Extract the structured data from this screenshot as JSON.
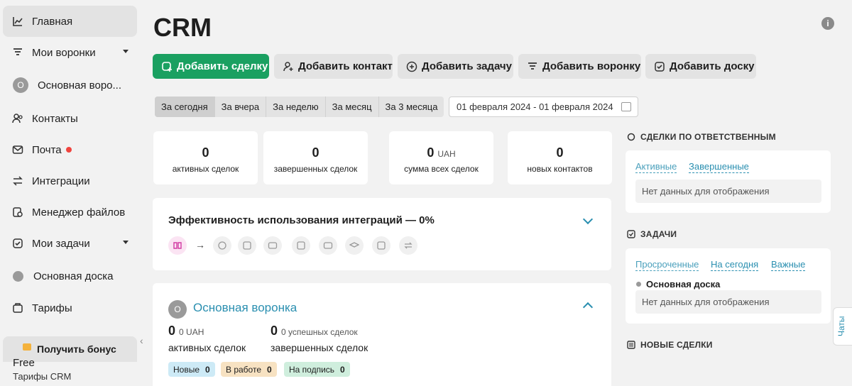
{
  "sidebar": {
    "items": [
      {
        "label": "Главная",
        "icon": "chart-line-icon"
      },
      {
        "label": "Мои воронки",
        "icon": "funnel-icon"
      },
      {
        "label": "Основная воро...",
        "icon": "funnel-avatar-icon",
        "avatar": "О"
      },
      {
        "label": "Контакты",
        "icon": "contacts-icon"
      },
      {
        "label": "Почта",
        "icon": "mail-icon"
      },
      {
        "label": "Интеграции",
        "icon": "integrations-icon"
      },
      {
        "label": "Менеджер файлов",
        "icon": "files-icon"
      },
      {
        "label": "Мои задачи",
        "icon": "tasks-icon"
      },
      {
        "label": "Основная доска",
        "icon": "board-dot-icon"
      },
      {
        "label": "Тарифы",
        "icon": "tariffs-icon"
      }
    ],
    "bonus_label": "Получить бонус",
    "plan_name": "Free",
    "plan_sub": "Тарифы CRM"
  },
  "header": {
    "title": "CRM"
  },
  "actions": {
    "add_deal": "Добавить сделку",
    "add_contact": "Добавить контакт",
    "add_task": "Добавить задачу",
    "add_funnel": "Добавить воронку",
    "add_board": "Добавить доску"
  },
  "periods": [
    "За сегодня",
    "За вчера",
    "За неделю",
    "За месяц",
    "За 3 месяца"
  ],
  "date_range": "01 февраля 2024 - 01 февраля 2024",
  "stats": [
    {
      "value": "0",
      "unit": "",
      "label": "активных сделок"
    },
    {
      "value": "0",
      "unit": "",
      "label": "завершенных сделок"
    },
    {
      "value": "0",
      "unit": "UAH",
      "label": "сумма всех сделок"
    },
    {
      "value": "0",
      "unit": "",
      "label": "новых контактов"
    }
  ],
  "efficiency": {
    "title": "Эффективность использования интеграций — 0%"
  },
  "funnel": {
    "avatar": "О",
    "name": "Основная воронка",
    "active_count": "0",
    "active_sum": "0 UAH",
    "active_label": "активных сделок",
    "done_count": "0",
    "done_sub": "0 успешных сделок",
    "done_label": "завершенных сделок",
    "stages": [
      {
        "label": "Новые",
        "count": "0",
        "color": "#cdeaf6"
      },
      {
        "label": "В работе",
        "count": "0",
        "color": "#f7e2c2"
      },
      {
        "label": "На подпись",
        "count": "0",
        "color": "#cfeedd"
      }
    ]
  },
  "right": {
    "deals_by_owner": {
      "title": "СДЕЛКИ ПО ОТВЕТСТВЕННЫМ",
      "tabs": [
        "Активные",
        "Завершенные"
      ],
      "empty": "Нет данных для отображения"
    },
    "tasks": {
      "title": "ЗАДАЧИ",
      "tabs": [
        "Просроченные",
        "На сегодня",
        "Важные"
      ],
      "board": "Основная доска",
      "empty": "Нет данных для отображения"
    },
    "new_deals": {
      "title": "НОВЫЕ СДЕЛКИ"
    }
  },
  "chats_label": "Чаты",
  "info_icon_glyph": "i"
}
